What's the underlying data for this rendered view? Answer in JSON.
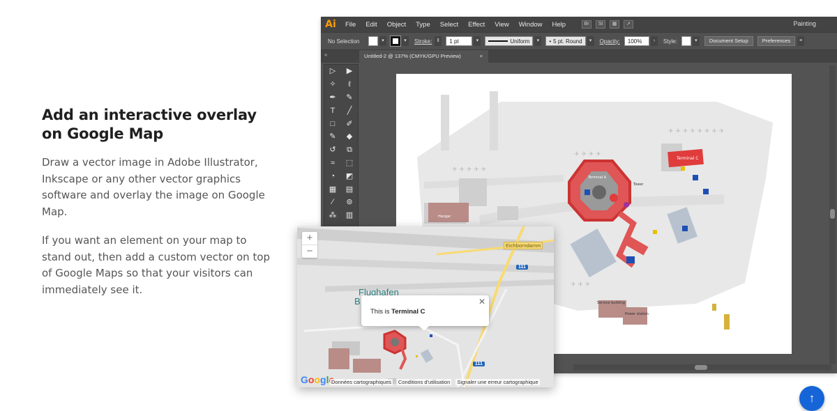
{
  "section": {
    "title": "Add an interactive overlay on Google Map",
    "paragraph_1": "Draw a vector image in Adobe Illustrator, Inkscape or any other vector graphics software and overlay the image on Google Map.",
    "paragraph_2": "If you want an element on your map to stand out, then add a custom vector on top of Google Maps so that your visitors can immediately see it."
  },
  "illustrator": {
    "logo": "Ai",
    "menu": [
      "File",
      "Edit",
      "Object",
      "Type",
      "Select",
      "Effect",
      "View",
      "Window",
      "Help"
    ],
    "workspace": "Painting",
    "control_bar": {
      "selection": "No Selection",
      "stroke_label": "Stroke:",
      "stroke_weight": "1 pt",
      "profile": "Uniform",
      "brush": "5 pt. Round",
      "opacity_label": "Opacity:",
      "opacity_value": "100%",
      "style_label": "Style:",
      "document_setup": "Document Setup",
      "preferences": "Preferences"
    },
    "document_tab": "Untitled-2 @ 137% (CMYK/GPU Preview)",
    "artboard_labels": {
      "terminal_c": "Terminal C",
      "terminal_a": "Terminal A",
      "tower": "Tower",
      "service_building": "Service building",
      "power_station": "Power station",
      "hangar": "Hangar"
    }
  },
  "google_map": {
    "street": "Eichborndamm",
    "route_top": "111",
    "route_bottom": "111",
    "place_name": "Flughafen",
    "place_name_2": "B",
    "info_window": {
      "prefix": "This is ",
      "highlight": "Terminal C"
    },
    "zoom_in": "+",
    "zoom_out": "−",
    "google_logo": "Google",
    "attribution": [
      "Données cartographiques",
      "Conditions d'utilisation",
      "Signaler une erreur cartographique"
    ],
    "colors": {
      "terminal_red": "#e03c3c",
      "road_yellow": "#f8da73",
      "route_blue": "#2164b9"
    }
  },
  "scroll_top_button": {
    "icon": "arrow-up-icon",
    "glyph": "↑"
  }
}
